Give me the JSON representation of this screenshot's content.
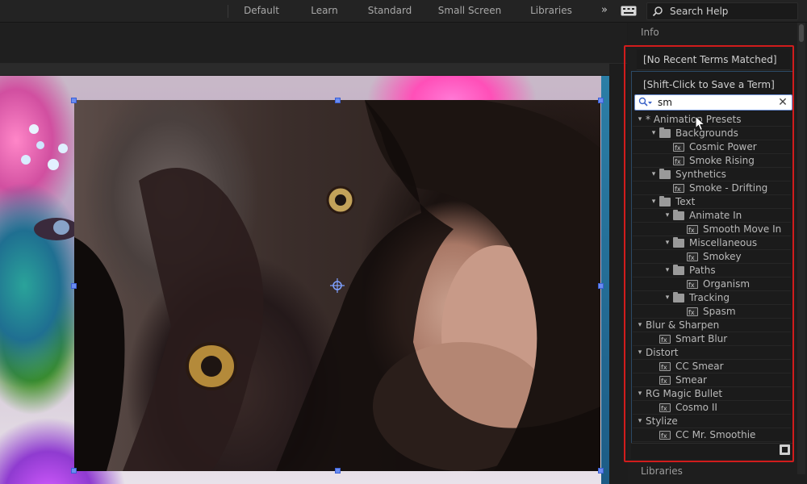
{
  "workspace": {
    "tabs": [
      "Default",
      "Learn",
      "Standard",
      "Small Screen",
      "Libraries"
    ],
    "more": "»",
    "search_help_placeholder": "Search Help"
  },
  "right_panel": {
    "info_header": "Info",
    "recent_terms": "[No Recent Terms Matched]",
    "save_term_hint": "[Shift-Click to Save a Term]",
    "search_value": "sm",
    "libraries_header": "Libraries"
  },
  "effects_tree": [
    {
      "label": "* Animation Presets",
      "depth": 0,
      "kind": "group",
      "expanded": true
    },
    {
      "label": "Backgrounds",
      "depth": 1,
      "kind": "folder",
      "expanded": true
    },
    {
      "label": "Cosmic Power",
      "depth": 2,
      "kind": "preset"
    },
    {
      "label": "Smoke Rising",
      "depth": 2,
      "kind": "preset"
    },
    {
      "label": "Synthetics",
      "depth": 1,
      "kind": "folder",
      "expanded": true
    },
    {
      "label": "Smoke - Drifting",
      "depth": 2,
      "kind": "preset"
    },
    {
      "label": "Text",
      "depth": 1,
      "kind": "folder",
      "expanded": true
    },
    {
      "label": "Animate In",
      "depth": 2,
      "kind": "folder",
      "expanded": true
    },
    {
      "label": "Smooth Move In",
      "depth": 3,
      "kind": "preset"
    },
    {
      "label": "Miscellaneous",
      "depth": 2,
      "kind": "folder",
      "expanded": true
    },
    {
      "label": "Smokey",
      "depth": 3,
      "kind": "preset"
    },
    {
      "label": "Paths",
      "depth": 2,
      "kind": "folder",
      "expanded": true
    },
    {
      "label": "Organism",
      "depth": 3,
      "kind": "preset"
    },
    {
      "label": "Tracking",
      "depth": 2,
      "kind": "folder",
      "expanded": true
    },
    {
      "label": "Spasm",
      "depth": 3,
      "kind": "preset"
    },
    {
      "label": "Blur & Sharpen",
      "depth": 0,
      "kind": "group",
      "expanded": true
    },
    {
      "label": "Smart Blur",
      "depth": 1,
      "kind": "effect"
    },
    {
      "label": "Distort",
      "depth": 0,
      "kind": "group",
      "expanded": true
    },
    {
      "label": "CC Smear",
      "depth": 1,
      "kind": "effect"
    },
    {
      "label": "Smear",
      "depth": 1,
      "kind": "effect"
    },
    {
      "label": "RG Magic Bullet",
      "depth": 0,
      "kind": "group",
      "expanded": true
    },
    {
      "label": "Cosmo II",
      "depth": 1,
      "kind": "effect"
    },
    {
      "label": "Stylize",
      "depth": 0,
      "kind": "group",
      "expanded": true
    },
    {
      "label": "CC Mr. Smoothie",
      "depth": 1,
      "kind": "effect"
    }
  ],
  "colors": {
    "highlight_outline": "#d11c1c",
    "selection_handle": "#6a8cf0"
  }
}
